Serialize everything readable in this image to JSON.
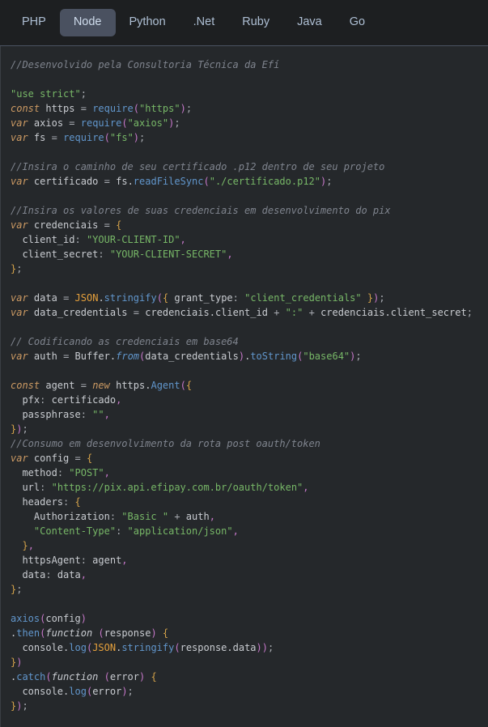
{
  "window": {
    "title": "Efí Pix OAuth token code sample",
    "background_color": "#1d1f21",
    "code_background_color": "#25282b"
  },
  "tabs": {
    "name": "language-tabs",
    "active": "Node",
    "items": [
      {
        "id": "php",
        "label": "PHP",
        "active": false
      },
      {
        "id": "node",
        "label": "Node",
        "active": true
      },
      {
        "id": "python",
        "label": "Python",
        "active": false
      },
      {
        "id": "net",
        "label": ".Net",
        "active": false
      },
      {
        "id": "ruby",
        "label": "Ruby",
        "active": false
      },
      {
        "id": "java",
        "label": "Java",
        "active": false
      },
      {
        "id": "go",
        "label": "Go",
        "active": false
      }
    ]
  },
  "palette": {
    "comment": "#7f848e",
    "keyword": "#cc9a63",
    "identifier": "#c9ccd1",
    "function": "#6196cc",
    "string": "#77b767",
    "object": "#e5a03c",
    "operator": "#a7aab0",
    "punctuation": "#c678c9",
    "brace": "#d4a24a",
    "active_tab_background": "#4a5160",
    "tab_text": "#aebfd4"
  },
  "code": {
    "language": "Node",
    "lines": [
      "//Desenvolvido pela Consultoria Técnica da Efí",
      "",
      "\"use strict\";",
      "const https = require(\"https\");",
      "var axios = require(\"axios\");",
      "var fs = require(\"fs\");",
      "",
      "//Insira o caminho de seu certificado .p12 dentro de seu projeto",
      "var certificado = fs.readFileSync(\"./certificado.p12\");",
      "",
      "//Insira os valores de suas credenciais em desenvolvimento do pix",
      "var credenciais = {",
      "  client_id: \"YOUR-CLIENT-ID\",",
      "  client_secret: \"YOUR-CLIENT-SECRET\",",
      "};",
      "",
      "var data = JSON.stringify({ grant_type: \"client_credentials\" });",
      "var data_credentials = credenciais.client_id + \":\" + credenciais.client_secret;",
      "",
      "// Codificando as credenciais em base64",
      "var auth = Buffer.from(data_credentials).toString(\"base64\");",
      "",
      "const agent = new https.Agent({",
      "  pfx: certificado,",
      "  passphrase: \"\",",
      "});",
      "//Consumo em desenvolvimento da rota post oauth/token",
      "var config = {",
      "  method: \"POST\",",
      "  url: \"https://pix.api.efipay.com.br/oauth/token\",",
      "  headers: {",
      "    Authorization: \"Basic \" + auth,",
      "    \"Content-Type\": \"application/json\",",
      "  },",
      "  httpsAgent: agent,",
      "  data: data,",
      "};",
      "",
      "axios(config)",
      ".then(function (response) {",
      "  console.log(JSON.stringify(response.data));",
      "})",
      ".catch(function (error) {",
      "  console.log(error);",
      "});"
    ],
    "values": {
      "client_id": "YOUR-CLIENT-ID",
      "client_secret": "YOUR-CLIENT-SECRET",
      "certificate_path": "./certificado.p12",
      "grant_type": "client_credentials",
      "method": "POST",
      "url": "https://pix.api.efipay.com.br/oauth/token",
      "authorization_prefix": "Basic ",
      "content_type": "application/json",
      "passphrase": "",
      "encoding": "base64",
      "strict_directive": "use strict"
    },
    "comments": [
      "//Desenvolvido pela Consultoria Técnica da Efí",
      "//Insira o caminho de seu certificado .p12 dentro de seu projeto",
      "//Insira os valores de suas credenciais em desenvolvimento do pix",
      "// Codificando as credenciais em base64",
      "//Consumo em desenvolvimento da rota post oauth/token"
    ]
  }
}
